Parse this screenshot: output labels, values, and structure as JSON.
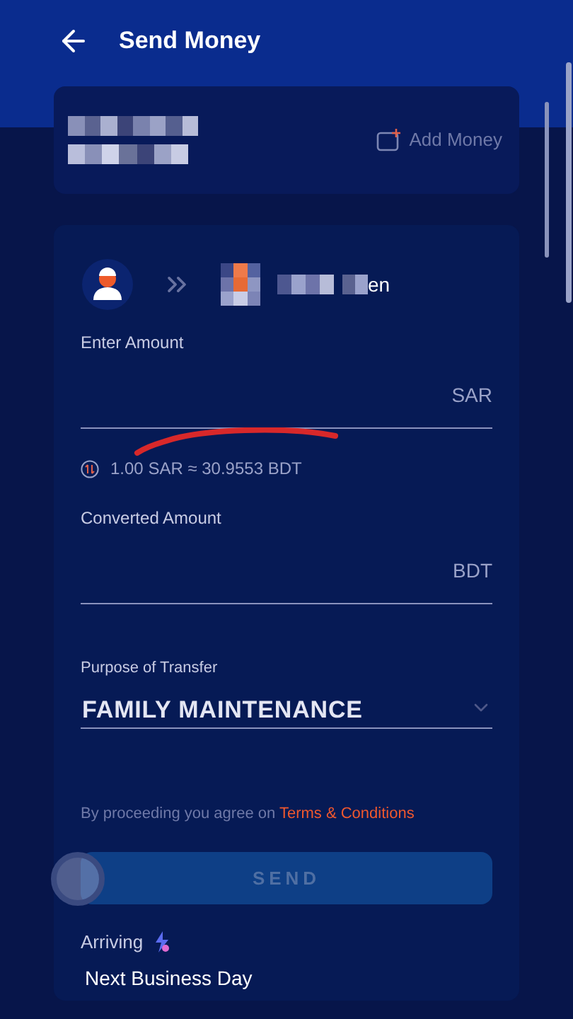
{
  "header": {
    "title": "Send Money"
  },
  "balance_card": {
    "action": "Add Money"
  },
  "recipient": {
    "name_visible": "en"
  },
  "amount": {
    "label": "Enter Amount",
    "currency": "SAR"
  },
  "rate": {
    "text": "1.00 SAR ≈ 30.9553 BDT"
  },
  "converted": {
    "label": "Converted Amount",
    "currency": "BDT"
  },
  "purpose": {
    "label": "Purpose of Transfer",
    "value": "FAMILY MAINTENANCE"
  },
  "terms": {
    "text": "By proceeding you agree on",
    "link": "Terms & Conditions"
  },
  "send_button": {
    "label": "SEND",
    "disabled": true
  },
  "arrival": {
    "label": "Arriving",
    "value": "Next Business Day"
  }
}
